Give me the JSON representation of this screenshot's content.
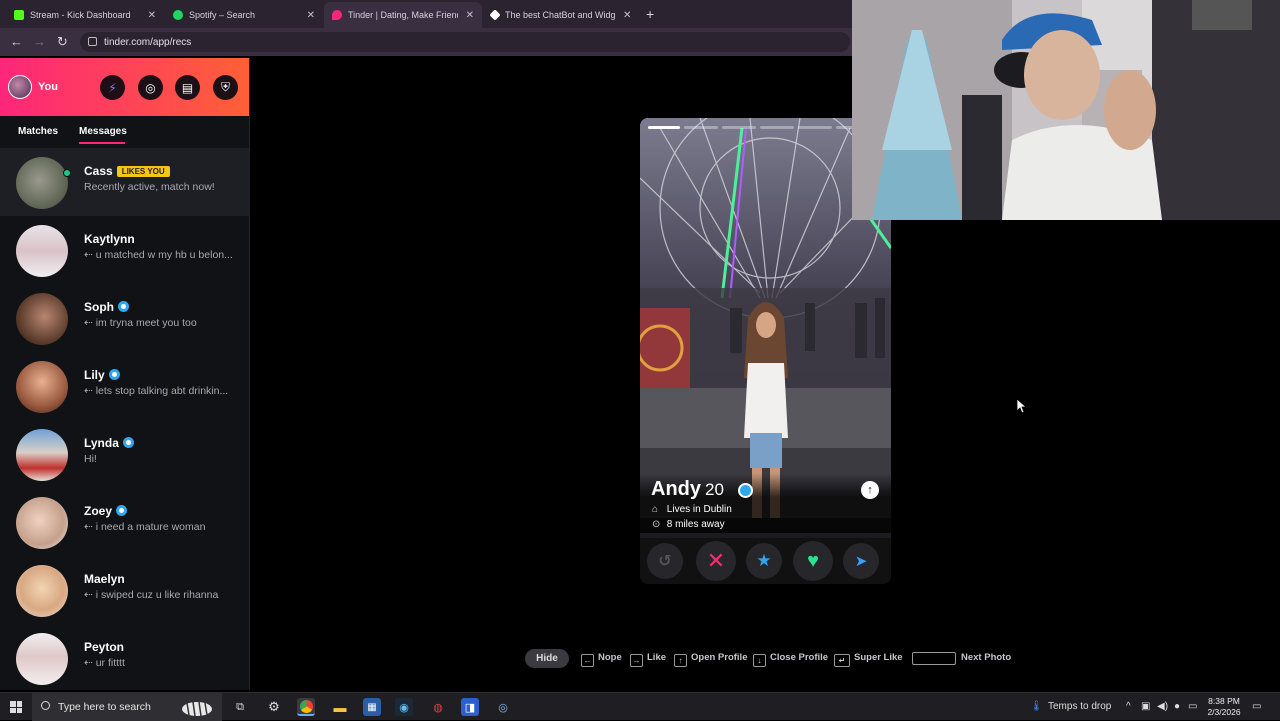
{
  "browser": {
    "tabs": [
      {
        "label": "Stream - Kick Dashboard",
        "color": "#53fc18"
      },
      {
        "label": "Spotify – Search",
        "color": "#1ed760"
      },
      {
        "label": "Tinder | Dating, Make Friends &",
        "color": "#fd267a"
      },
      {
        "label": "The best ChatBot and Widgets",
        "color": "#ffffff"
      }
    ],
    "url": "tinder.com/app/recs"
  },
  "sidebar": {
    "you_label": "You",
    "tabs": {
      "matches": "Matches",
      "messages": "Messages"
    },
    "conversations": [
      {
        "name": "Cass",
        "badge": "LIKES YOU",
        "preview": "Recently active, match now!"
      },
      {
        "name": "Kaytlynn",
        "preview": "u matched w my hb u belon..."
      },
      {
        "name": "Soph",
        "verified": true,
        "preview": "im tryna meet you too"
      },
      {
        "name": "Lily",
        "verified": true,
        "preview": "lets stop talking abt drinkin..."
      },
      {
        "name": "Lynda",
        "verified": true,
        "preview": "Hi!"
      },
      {
        "name": "Zoey",
        "verified": true,
        "preview": "i need a mature woman"
      },
      {
        "name": "Maelyn",
        "preview": "i swiped cuz u like rihanna"
      },
      {
        "name": "Peyton",
        "preview": "ur fitttt"
      }
    ]
  },
  "profile": {
    "name": "Andy",
    "age": "20",
    "lives_in": "Lives in Dublin",
    "distance": "8 miles away",
    "photo_count": 6,
    "current_photo_index": 0
  },
  "shortcuts": {
    "hide": "Hide",
    "nope": "Nope",
    "like": "Like",
    "open_profile": "Open Profile",
    "close_profile": "Close Profile",
    "super_like": "Super Like",
    "next_photo": "Next Photo"
  },
  "taskbar": {
    "search_placeholder": "Type here to search",
    "weather": "Temps to drop",
    "time": "8:38 PM",
    "date": "2/3/2026"
  },
  "colors": {
    "brand_gradient_start": "#fd267a",
    "brand_gradient_end": "#ff6036",
    "verified": "#2ea7f0",
    "likes_you_badge": "#f5c518"
  }
}
